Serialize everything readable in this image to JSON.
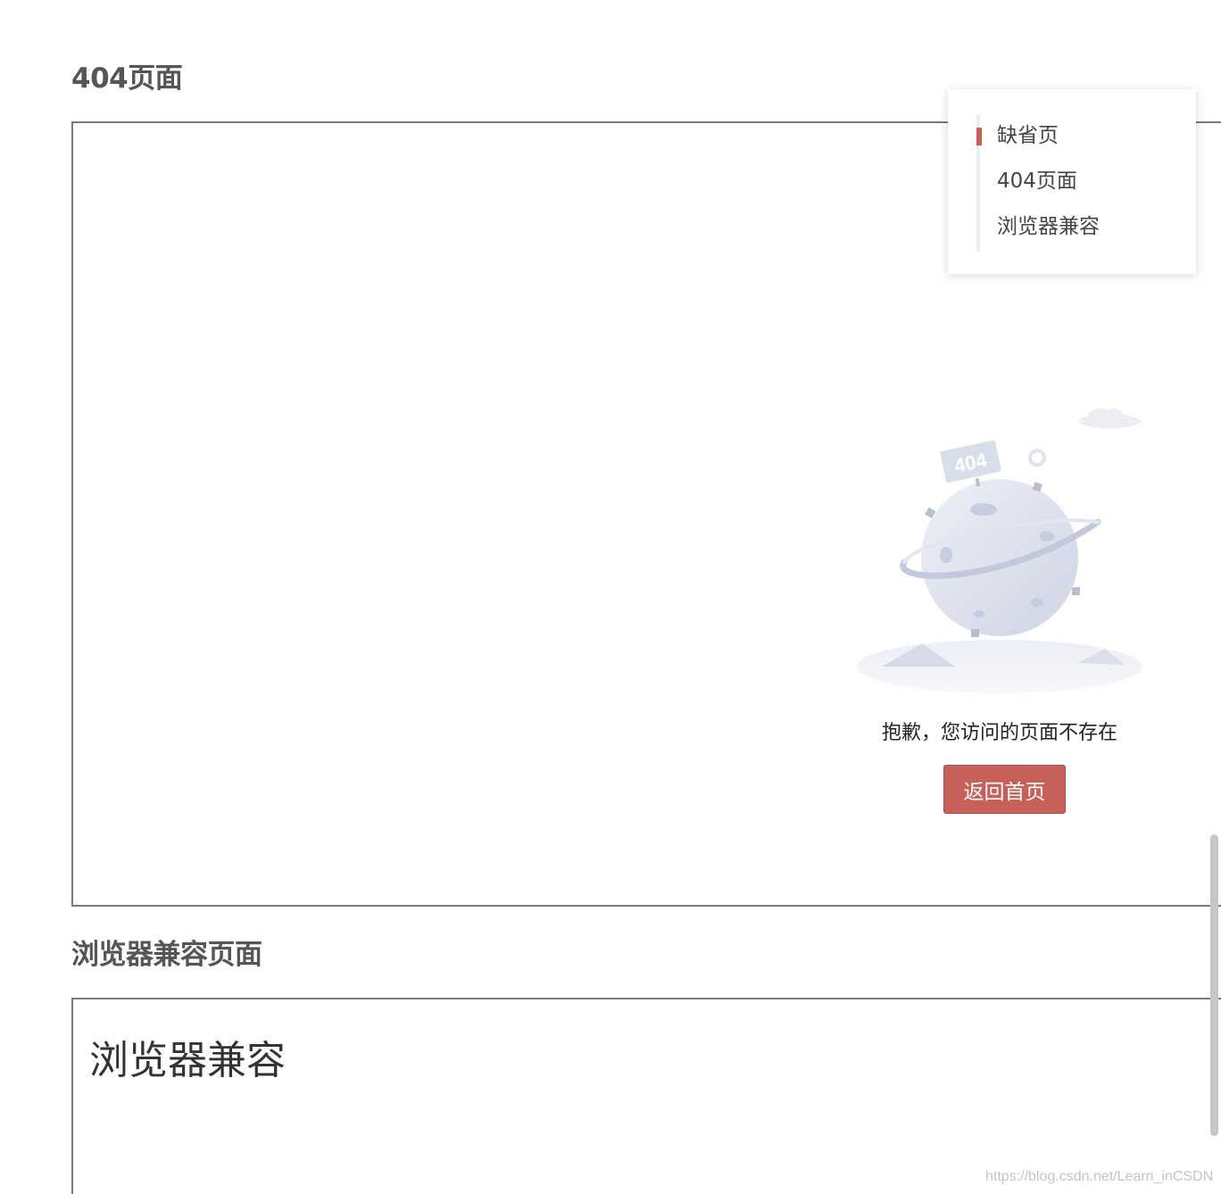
{
  "sections": {
    "not_found": {
      "title": "404页面",
      "sign_text": "404",
      "message": "抱歉，您访问的页面不存在",
      "button_label": "返回首页"
    },
    "browser_compat": {
      "title": "浏览器兼容页面",
      "content_heading": "浏览器兼容"
    }
  },
  "toc": {
    "items": [
      {
        "label": "缺省页",
        "active": true
      },
      {
        "label": "404页面",
        "active": false
      },
      {
        "label": "浏览器兼容",
        "active": false
      }
    ]
  },
  "watermark": "https://blog.csdn.net/Learn_inCSDN",
  "colors": {
    "accent": "#c8605a",
    "frame_border": "#7a7a7a",
    "title_text": "#555555",
    "illustration": "#d6dbe9"
  },
  "icons": {
    "illustration": "planet-404-icon"
  }
}
